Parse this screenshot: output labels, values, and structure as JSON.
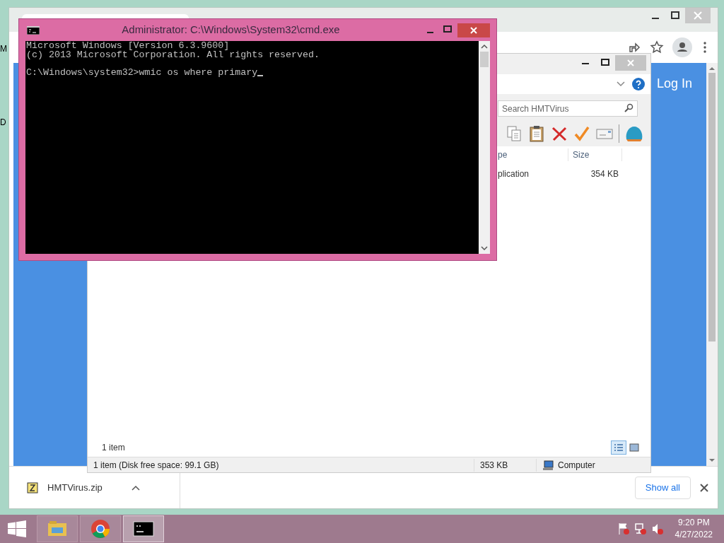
{
  "desktop": {
    "edge_labels": [
      "M",
      "D"
    ]
  },
  "browser": {
    "page": {
      "login_link": "Log In"
    },
    "download_bar": {
      "file_name": "HMTVirus.zip",
      "show_all": "Show all"
    }
  },
  "explorer": {
    "search": {
      "placeholder": "Search HMTVirus"
    },
    "columns": [
      "pe",
      "Size"
    ],
    "rows": [
      {
        "type": "plication",
        "size": "354 KB"
      }
    ],
    "item_count": "1 item",
    "views": [
      {
        "kind": "details",
        "selected": true
      },
      {
        "kind": "preview",
        "selected": false
      }
    ],
    "status_bar": {
      "summary": "1 item (Disk free space: 99.1 GB)",
      "size": "353 KB",
      "location": "Computer"
    }
  },
  "console": {
    "title": "Administrator: C:\\Windows\\System32\\cmd.exe",
    "lines": [
      {
        "text": "Microsoft Windows [Version 6.3.9600]",
        "gap_before": false
      },
      {
        "text": "(c) 2013 Microsoft Corporation. All rights reserved.",
        "gap_before": false
      },
      {
        "text": "C:\\Windows\\system32>wmic os where primary",
        "gap_before": true
      }
    ]
  },
  "taskbar": {
    "apps": [
      {
        "kind": "explorer",
        "selected": false
      },
      {
        "kind": "chrome",
        "selected": false
      },
      {
        "kind": "console",
        "selected": true
      }
    ],
    "clock": {
      "time": "9:20 PM",
      "date": "4/27/2022"
    }
  }
}
